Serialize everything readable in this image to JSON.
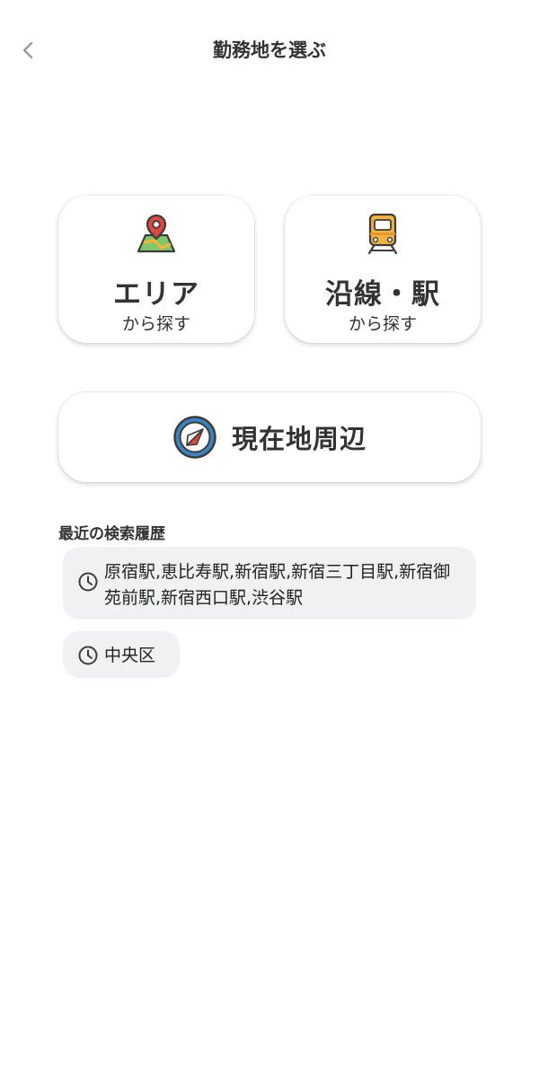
{
  "header": {
    "title": "勤務地を選ぶ",
    "back_icon": "chevron-left-icon"
  },
  "search_options": {
    "area": {
      "title": "エリア",
      "subtitle": "から探す",
      "icon": "map-pin-icon"
    },
    "line_station": {
      "title": "沿線・駅",
      "subtitle": "から探す",
      "icon": "train-icon"
    },
    "nearby": {
      "label": "現在地周辺",
      "icon": "compass-icon"
    }
  },
  "history": {
    "title": "最近の検索履歴",
    "items": [
      {
        "text": "原宿駅,恵比寿駅,新宿駅,新宿三丁目駅,新宿御苑前駅,新宿西口駅,渋谷駅",
        "icon": "clock-icon"
      },
      {
        "text": "中央区",
        "icon": "clock-icon"
      }
    ]
  },
  "colors": {
    "text": "#333333",
    "card_bg": "#ffffff",
    "history_bg": "#f0f1f4",
    "map_green": "#7ec86a",
    "pin_red": "#e0473f",
    "train_yellow": "#f3b33d",
    "compass_blue": "#3a84c4"
  }
}
